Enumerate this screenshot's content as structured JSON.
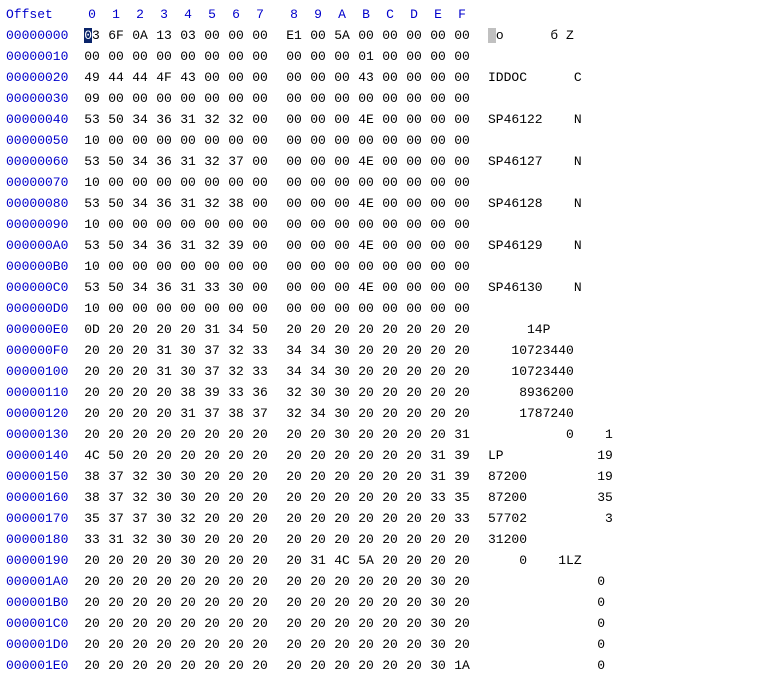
{
  "header": {
    "offset_label": "Offset",
    "cols": [
      "0",
      "1",
      "2",
      "3",
      "4",
      "5",
      "6",
      "7",
      "8",
      "9",
      "A",
      "B",
      "C",
      "D",
      "E",
      "F"
    ]
  },
  "rows": [
    {
      "off": "00000000",
      "hex": [
        "03",
        "6F",
        "0A",
        "13",
        "03",
        "00",
        "00",
        "00",
        "E1",
        "00",
        "5A",
        "00",
        "00",
        "00",
        "00",
        "00"
      ],
      "ascii": " o      б Z     "
    },
    {
      "off": "00000010",
      "hex": [
        "00",
        "00",
        "00",
        "00",
        "00",
        "00",
        "00",
        "00",
        "00",
        "00",
        "00",
        "01",
        "00",
        "00",
        "00",
        "00"
      ],
      "ascii": "                "
    },
    {
      "off": "00000020",
      "hex": [
        "49",
        "44",
        "44",
        "4F",
        "43",
        "00",
        "00",
        "00",
        "00",
        "00",
        "00",
        "43",
        "00",
        "00",
        "00",
        "00"
      ],
      "ascii": "IDDOC      C    "
    },
    {
      "off": "00000030",
      "hex": [
        "09",
        "00",
        "00",
        "00",
        "00",
        "00",
        "00",
        "00",
        "00",
        "00",
        "00",
        "00",
        "00",
        "00",
        "00",
        "00"
      ],
      "ascii": "                "
    },
    {
      "off": "00000040",
      "hex": [
        "53",
        "50",
        "34",
        "36",
        "31",
        "32",
        "32",
        "00",
        "00",
        "00",
        "00",
        "4E",
        "00",
        "00",
        "00",
        "00"
      ],
      "ascii": "SP46122    N    "
    },
    {
      "off": "00000050",
      "hex": [
        "10",
        "00",
        "00",
        "00",
        "00",
        "00",
        "00",
        "00",
        "00",
        "00",
        "00",
        "00",
        "00",
        "00",
        "00",
        "00"
      ],
      "ascii": "                "
    },
    {
      "off": "00000060",
      "hex": [
        "53",
        "50",
        "34",
        "36",
        "31",
        "32",
        "37",
        "00",
        "00",
        "00",
        "00",
        "4E",
        "00",
        "00",
        "00",
        "00"
      ],
      "ascii": "SP46127    N    "
    },
    {
      "off": "00000070",
      "hex": [
        "10",
        "00",
        "00",
        "00",
        "00",
        "00",
        "00",
        "00",
        "00",
        "00",
        "00",
        "00",
        "00",
        "00",
        "00",
        "00"
      ],
      "ascii": "                "
    },
    {
      "off": "00000080",
      "hex": [
        "53",
        "50",
        "34",
        "36",
        "31",
        "32",
        "38",
        "00",
        "00",
        "00",
        "00",
        "4E",
        "00",
        "00",
        "00",
        "00"
      ],
      "ascii": "SP46128    N    "
    },
    {
      "off": "00000090",
      "hex": [
        "10",
        "00",
        "00",
        "00",
        "00",
        "00",
        "00",
        "00",
        "00",
        "00",
        "00",
        "00",
        "00",
        "00",
        "00",
        "00"
      ],
      "ascii": "                "
    },
    {
      "off": "000000A0",
      "hex": [
        "53",
        "50",
        "34",
        "36",
        "31",
        "32",
        "39",
        "00",
        "00",
        "00",
        "00",
        "4E",
        "00",
        "00",
        "00",
        "00"
      ],
      "ascii": "SP46129    N    "
    },
    {
      "off": "000000B0",
      "hex": [
        "10",
        "00",
        "00",
        "00",
        "00",
        "00",
        "00",
        "00",
        "00",
        "00",
        "00",
        "00",
        "00",
        "00",
        "00",
        "00"
      ],
      "ascii": "                "
    },
    {
      "off": "000000C0",
      "hex": [
        "53",
        "50",
        "34",
        "36",
        "31",
        "33",
        "30",
        "00",
        "00",
        "00",
        "00",
        "4E",
        "00",
        "00",
        "00",
        "00"
      ],
      "ascii": "SP46130    N    "
    },
    {
      "off": "000000D0",
      "hex": [
        "10",
        "00",
        "00",
        "00",
        "00",
        "00",
        "00",
        "00",
        "00",
        "00",
        "00",
        "00",
        "00",
        "00",
        "00",
        "00"
      ],
      "ascii": "                "
    },
    {
      "off": "000000E0",
      "hex": [
        "0D",
        "20",
        "20",
        "20",
        "20",
        "31",
        "34",
        "50",
        "20",
        "20",
        "20",
        "20",
        "20",
        "20",
        "20",
        "20"
      ],
      "ascii": "     14P        "
    },
    {
      "off": "000000F0",
      "hex": [
        "20",
        "20",
        "20",
        "31",
        "30",
        "37",
        "32",
        "33",
        "34",
        "34",
        "30",
        "20",
        "20",
        "20",
        "20",
        "20"
      ],
      "ascii": "   10723440     "
    },
    {
      "off": "00000100",
      "hex": [
        "20",
        "20",
        "20",
        "31",
        "30",
        "37",
        "32",
        "33",
        "34",
        "34",
        "30",
        "20",
        "20",
        "20",
        "20",
        "20"
      ],
      "ascii": "   10723440     "
    },
    {
      "off": "00000110",
      "hex": [
        "20",
        "20",
        "20",
        "20",
        "38",
        "39",
        "33",
        "36",
        "32",
        "30",
        "30",
        "20",
        "20",
        "20",
        "20",
        "20"
      ],
      "ascii": "    8936200     "
    },
    {
      "off": "00000120",
      "hex": [
        "20",
        "20",
        "20",
        "20",
        "31",
        "37",
        "38",
        "37",
        "32",
        "34",
        "30",
        "20",
        "20",
        "20",
        "20",
        "20"
      ],
      "ascii": "    1787240     "
    },
    {
      "off": "00000130",
      "hex": [
        "20",
        "20",
        "20",
        "20",
        "20",
        "20",
        "20",
        "20",
        "20",
        "20",
        "30",
        "20",
        "20",
        "20",
        "20",
        "31"
      ],
      "ascii": "          0    1"
    },
    {
      "off": "00000140",
      "hex": [
        "4C",
        "50",
        "20",
        "20",
        "20",
        "20",
        "20",
        "20",
        "20",
        "20",
        "20",
        "20",
        "20",
        "20",
        "31",
        "39"
      ],
      "ascii": "LP            19"
    },
    {
      "off": "00000150",
      "hex": [
        "38",
        "37",
        "32",
        "30",
        "30",
        "20",
        "20",
        "20",
        "20",
        "20",
        "20",
        "20",
        "20",
        "20",
        "31",
        "39"
      ],
      "ascii": "87200         19"
    },
    {
      "off": "00000160",
      "hex": [
        "38",
        "37",
        "32",
        "30",
        "30",
        "20",
        "20",
        "20",
        "20",
        "20",
        "20",
        "20",
        "20",
        "20",
        "33",
        "35"
      ],
      "ascii": "87200         35"
    },
    {
      "off": "00000170",
      "hex": [
        "35",
        "37",
        "37",
        "30",
        "32",
        "20",
        "20",
        "20",
        "20",
        "20",
        "20",
        "20",
        "20",
        "20",
        "20",
        "33"
      ],
      "ascii": "57702          3"
    },
    {
      "off": "00000180",
      "hex": [
        "33",
        "31",
        "32",
        "30",
        "30",
        "20",
        "20",
        "20",
        "20",
        "20",
        "20",
        "20",
        "20",
        "20",
        "20",
        "20"
      ],
      "ascii": "31200           "
    },
    {
      "off": "00000190",
      "hex": [
        "20",
        "20",
        "20",
        "20",
        "30",
        "20",
        "20",
        "20",
        "20",
        "31",
        "4C",
        "5A",
        "20",
        "20",
        "20",
        "20"
      ],
      "ascii": "    0    1LZ    "
    },
    {
      "off": "000001A0",
      "hex": [
        "20",
        "20",
        "20",
        "20",
        "20",
        "20",
        "20",
        "20",
        "20",
        "20",
        "20",
        "20",
        "20",
        "20",
        "30",
        "20"
      ],
      "ascii": "              0 "
    },
    {
      "off": "000001B0",
      "hex": [
        "20",
        "20",
        "20",
        "20",
        "20",
        "20",
        "20",
        "20",
        "20",
        "20",
        "20",
        "20",
        "20",
        "20",
        "30",
        "20"
      ],
      "ascii": "              0 "
    },
    {
      "off": "000001C0",
      "hex": [
        "20",
        "20",
        "20",
        "20",
        "20",
        "20",
        "20",
        "20",
        "20",
        "20",
        "20",
        "20",
        "20",
        "20",
        "30",
        "20"
      ],
      "ascii": "              0 "
    },
    {
      "off": "000001D0",
      "hex": [
        "20",
        "20",
        "20",
        "20",
        "20",
        "20",
        "20",
        "20",
        "20",
        "20",
        "20",
        "20",
        "20",
        "20",
        "30",
        "20"
      ],
      "ascii": "              0 "
    },
    {
      "off": "000001E0",
      "hex": [
        "20",
        "20",
        "20",
        "20",
        "20",
        "20",
        "20",
        "20",
        "20",
        "20",
        "20",
        "20",
        "20",
        "20",
        "30",
        "1A"
      ],
      "ascii": "              0 "
    }
  ],
  "selection": {
    "row": 0,
    "col": 0
  }
}
